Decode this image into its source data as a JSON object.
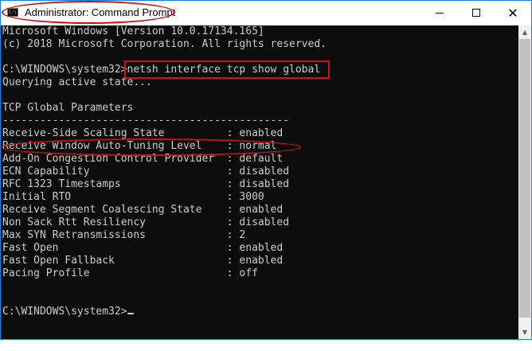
{
  "window": {
    "title": "Administrator: Command Prompt",
    "icon": "cmd-icon",
    "icon_glyph": "C:\\",
    "controls": {
      "minimize": "minimize-icon",
      "maximize": "maximize-icon",
      "close": "close-icon",
      "close_glyph": "✕"
    }
  },
  "console": {
    "lines": [
      "Microsoft Windows [Version 10.0.17134.165]",
      "(c) 2018 Microsoft Corporation. All rights reserved.",
      "",
      "C:\\WINDOWS\\system32>netsh interface tcp show global",
      "Querying active state...",
      "",
      "TCP Global Parameters",
      "----------------------------------------------",
      "Receive-Side Scaling State          : enabled",
      "Receive Window Auto-Tuning Level    : normal",
      "Add-On Congestion Control Provider  : default",
      "ECN Capability                      : disabled",
      "RFC 1323 Timestamps                 : disabled",
      "Initial RTO                         : 3000",
      "Receive Segment Coalescing State    : enabled",
      "Non Sack Rtt Resiliency             : disabled",
      "Max SYN Retransmissions             : 2",
      "Fast Open                           : enabled",
      "Fast Open Fallback                  : enabled",
      "Pacing Profile                      : off",
      "",
      "",
      "C:\\WINDOWS\\system32>"
    ],
    "colors": {
      "background": "#0c0c0c",
      "text": "#cccccc"
    }
  },
  "annotations": {
    "color": "#d01010"
  }
}
